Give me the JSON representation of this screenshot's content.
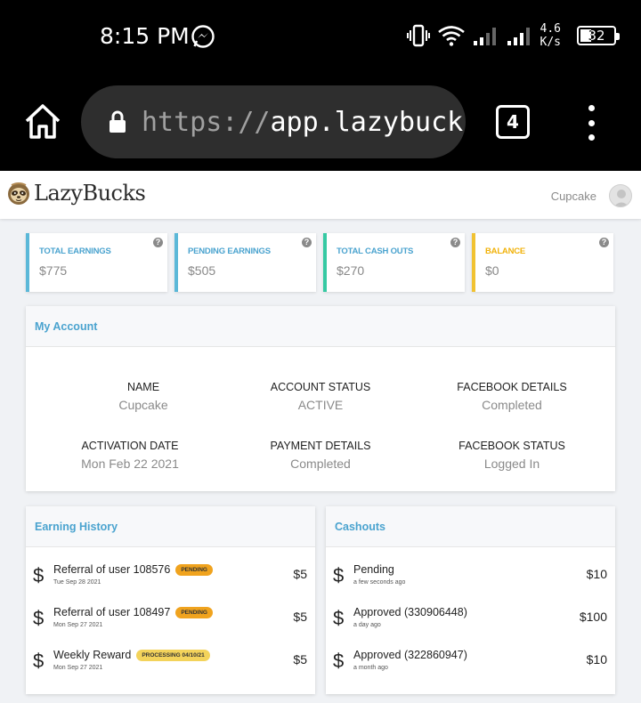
{
  "status_bar": {
    "time": "8:15 PM",
    "net_speed_value": "4.6",
    "net_speed_unit": "K/s",
    "battery": "32",
    "battery_level_pct": 32,
    "icons": [
      "messenger-icon",
      "vibrate-icon",
      "wifi-icon",
      "signal-icon",
      "signal-icon",
      "battery-icon"
    ]
  },
  "browser": {
    "url_scheme": "https://",
    "url_host": "app.lazybucks.co",
    "tab_count": "4"
  },
  "app": {
    "logo": "LazyBucks",
    "user_name": "Cupcake"
  },
  "stats": [
    {
      "label": "Total Earnings",
      "value": "$775",
      "accent": "#5bb8d8",
      "label_color": "#4aa3cf"
    },
    {
      "label": "Pending Earnings",
      "value": "$505",
      "accent": "#5bb8d8",
      "label_color": "#4aa3cf"
    },
    {
      "label": "Total Cash Outs",
      "value": "$270",
      "accent": "#36c9a3",
      "label_color": "#4aa3cf"
    },
    {
      "label": "Balance",
      "value": "$0",
      "accent": "#f1c232",
      "label_color": "#f1b20a"
    }
  ],
  "account": {
    "title": "My Account",
    "fields": [
      {
        "label": "Name",
        "value": "Cupcake"
      },
      {
        "label": "Account Status",
        "value": "ACTIVE"
      },
      {
        "label": "Facebook Details",
        "value": "Completed"
      },
      {
        "label": "Activation Date",
        "value": "Mon Feb 22 2021"
      },
      {
        "label": "Payment Details",
        "value": "Completed"
      },
      {
        "label": "Facebook Status",
        "value": "Logged In"
      }
    ]
  },
  "earning_history": {
    "title": "Earning History",
    "items": [
      {
        "title": "Referral of user 108576",
        "badge": "PENDING",
        "date": "Tue Sep 28 2021",
        "amount": "$5"
      },
      {
        "title": "Referral of user 108497",
        "badge": "PENDING",
        "date": "Mon Sep 27 2021",
        "amount": "$5"
      },
      {
        "title": "Weekly Reward",
        "badge": "PROCESSING 04/10/21",
        "date": "Mon Sep 27 2021",
        "amount": "$5"
      }
    ]
  },
  "cashouts": {
    "title": "Cashouts",
    "items": [
      {
        "title": "Pending",
        "date": "a few seconds ago",
        "amount": "$10"
      },
      {
        "title": "Approved (330906448)",
        "date": "a day ago",
        "amount": "$100"
      },
      {
        "title": "Approved (322860947)",
        "date": "a month ago",
        "amount": "$10"
      }
    ]
  },
  "colors": {
    "accent_blue": "#4aa3cf",
    "badge_pending": "#f0a31e",
    "badge_processing": "#f3d35b"
  }
}
